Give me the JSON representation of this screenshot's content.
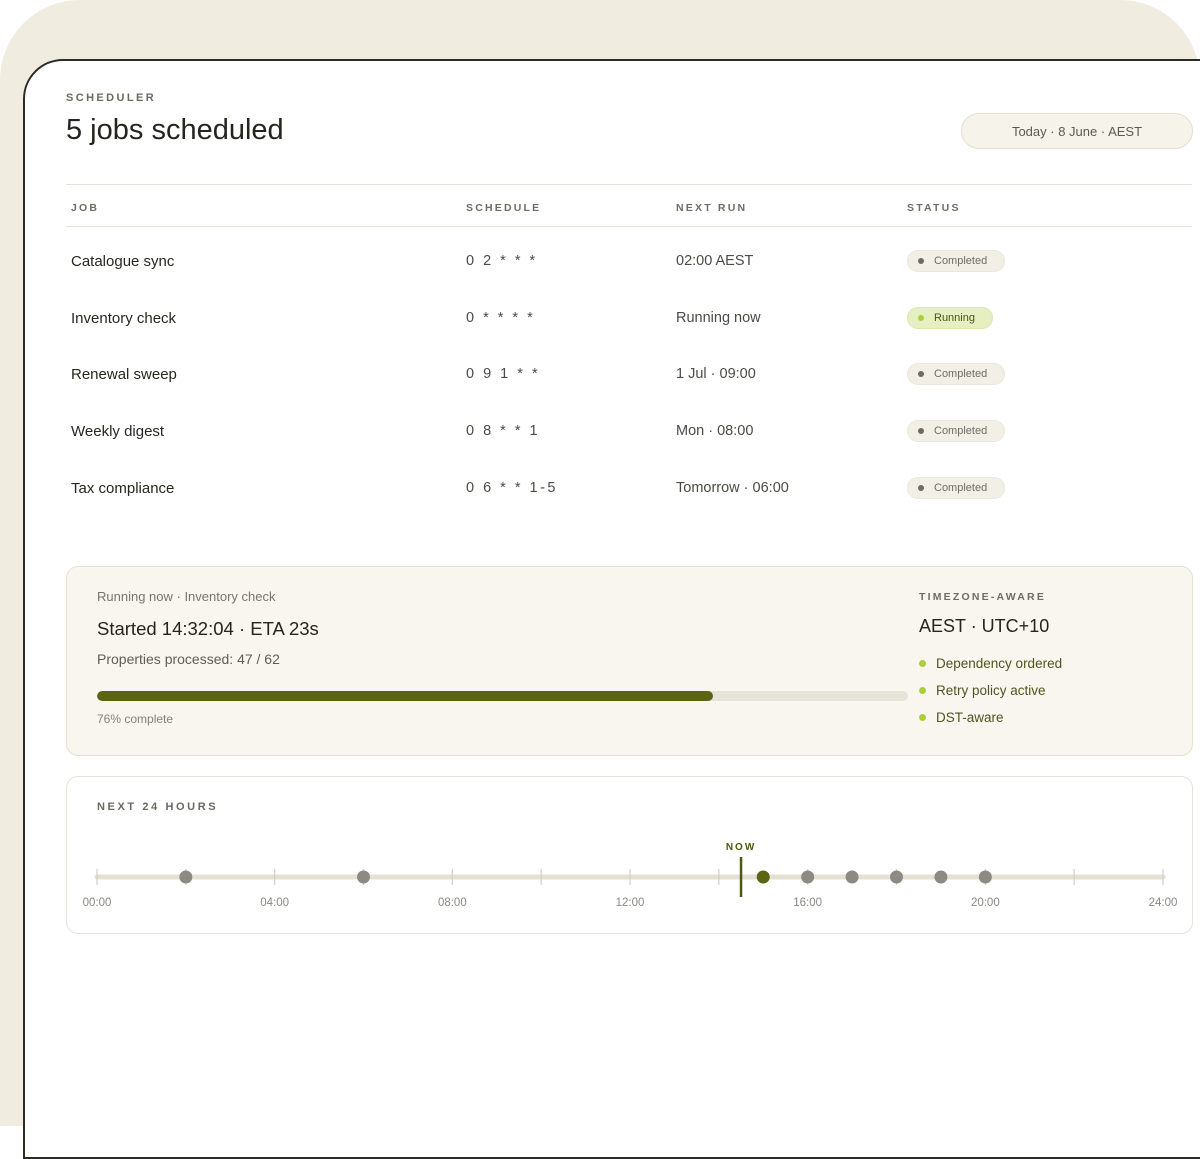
{
  "header": {
    "eyebrow": "SCHEDULER",
    "title": "5 jobs scheduled",
    "date_pill": "Today · 8 June · AEST"
  },
  "table": {
    "columns": [
      "JOB",
      "SCHEDULE",
      "NEXT RUN",
      "STATUS"
    ],
    "rows": [
      {
        "job": "Catalogue sync",
        "schedule": "0 2 * * *",
        "next_run": "02:00 AEST",
        "status": "Completed",
        "state": "completed"
      },
      {
        "job": "Inventory check",
        "schedule": "0 * * * *",
        "next_run": "Running now",
        "status": "Running",
        "state": "running"
      },
      {
        "job": "Renewal sweep",
        "schedule": "0 9 1 * *",
        "next_run": "1 Jul · 09:00",
        "status": "Completed",
        "state": "completed"
      },
      {
        "job": "Weekly digest",
        "schedule": "0 8 * * 1",
        "next_run": "Mon · 08:00",
        "status": "Completed",
        "state": "completed"
      },
      {
        "job": "Tax compliance",
        "schedule": "0 6 * * 1-5",
        "next_run": "Tomorrow · 06:00",
        "status": "Completed",
        "state": "completed"
      }
    ]
  },
  "run_panel": {
    "subtitle": "Running now · Inventory check",
    "headline": "Started 14:32:04 · ETA 23s",
    "properties": "Properties processed: 47 / 62",
    "progress_percent": 76,
    "progress_label": "76% complete"
  },
  "timezone": {
    "eyebrow": "TIMEZONE-AWARE",
    "title": "AEST · UTC+10",
    "features": [
      "Dependency ordered",
      "Retry policy active",
      "DST-aware"
    ]
  },
  "timeline": {
    "eyebrow": "NEXT 24 HOURS",
    "now_label": "NOW",
    "now_hour": 14.5,
    "range_hours": [
      0,
      24
    ],
    "tick_hours": [
      0,
      2,
      4,
      6,
      8,
      10,
      12,
      14,
      16,
      18,
      20,
      22,
      24
    ],
    "labels": [
      {
        "hour": 0,
        "text": "00:00"
      },
      {
        "hour": 4,
        "text": "04:00"
      },
      {
        "hour": 8,
        "text": "08:00"
      },
      {
        "hour": 12,
        "text": "12:00"
      },
      {
        "hour": 16,
        "text": "16:00"
      },
      {
        "hour": 20,
        "text": "20:00"
      },
      {
        "hour": 24,
        "text": "24:00"
      }
    ],
    "runs": [
      {
        "hour": 2,
        "state": "scheduled"
      },
      {
        "hour": 6,
        "state": "scheduled"
      },
      {
        "hour": 15,
        "state": "next"
      },
      {
        "hour": 16,
        "state": "scheduled"
      },
      {
        "hour": 17,
        "state": "scheduled"
      },
      {
        "hour": 18,
        "state": "scheduled"
      },
      {
        "hour": 19,
        "state": "scheduled"
      },
      {
        "hour": 20,
        "state": "scheduled"
      }
    ]
  },
  "colors": {
    "accent": "#5b6410",
    "running_dot": "#a9cf3d",
    "scheduled_dot": "#8c8b83",
    "backdrop": "#f0ece0"
  }
}
